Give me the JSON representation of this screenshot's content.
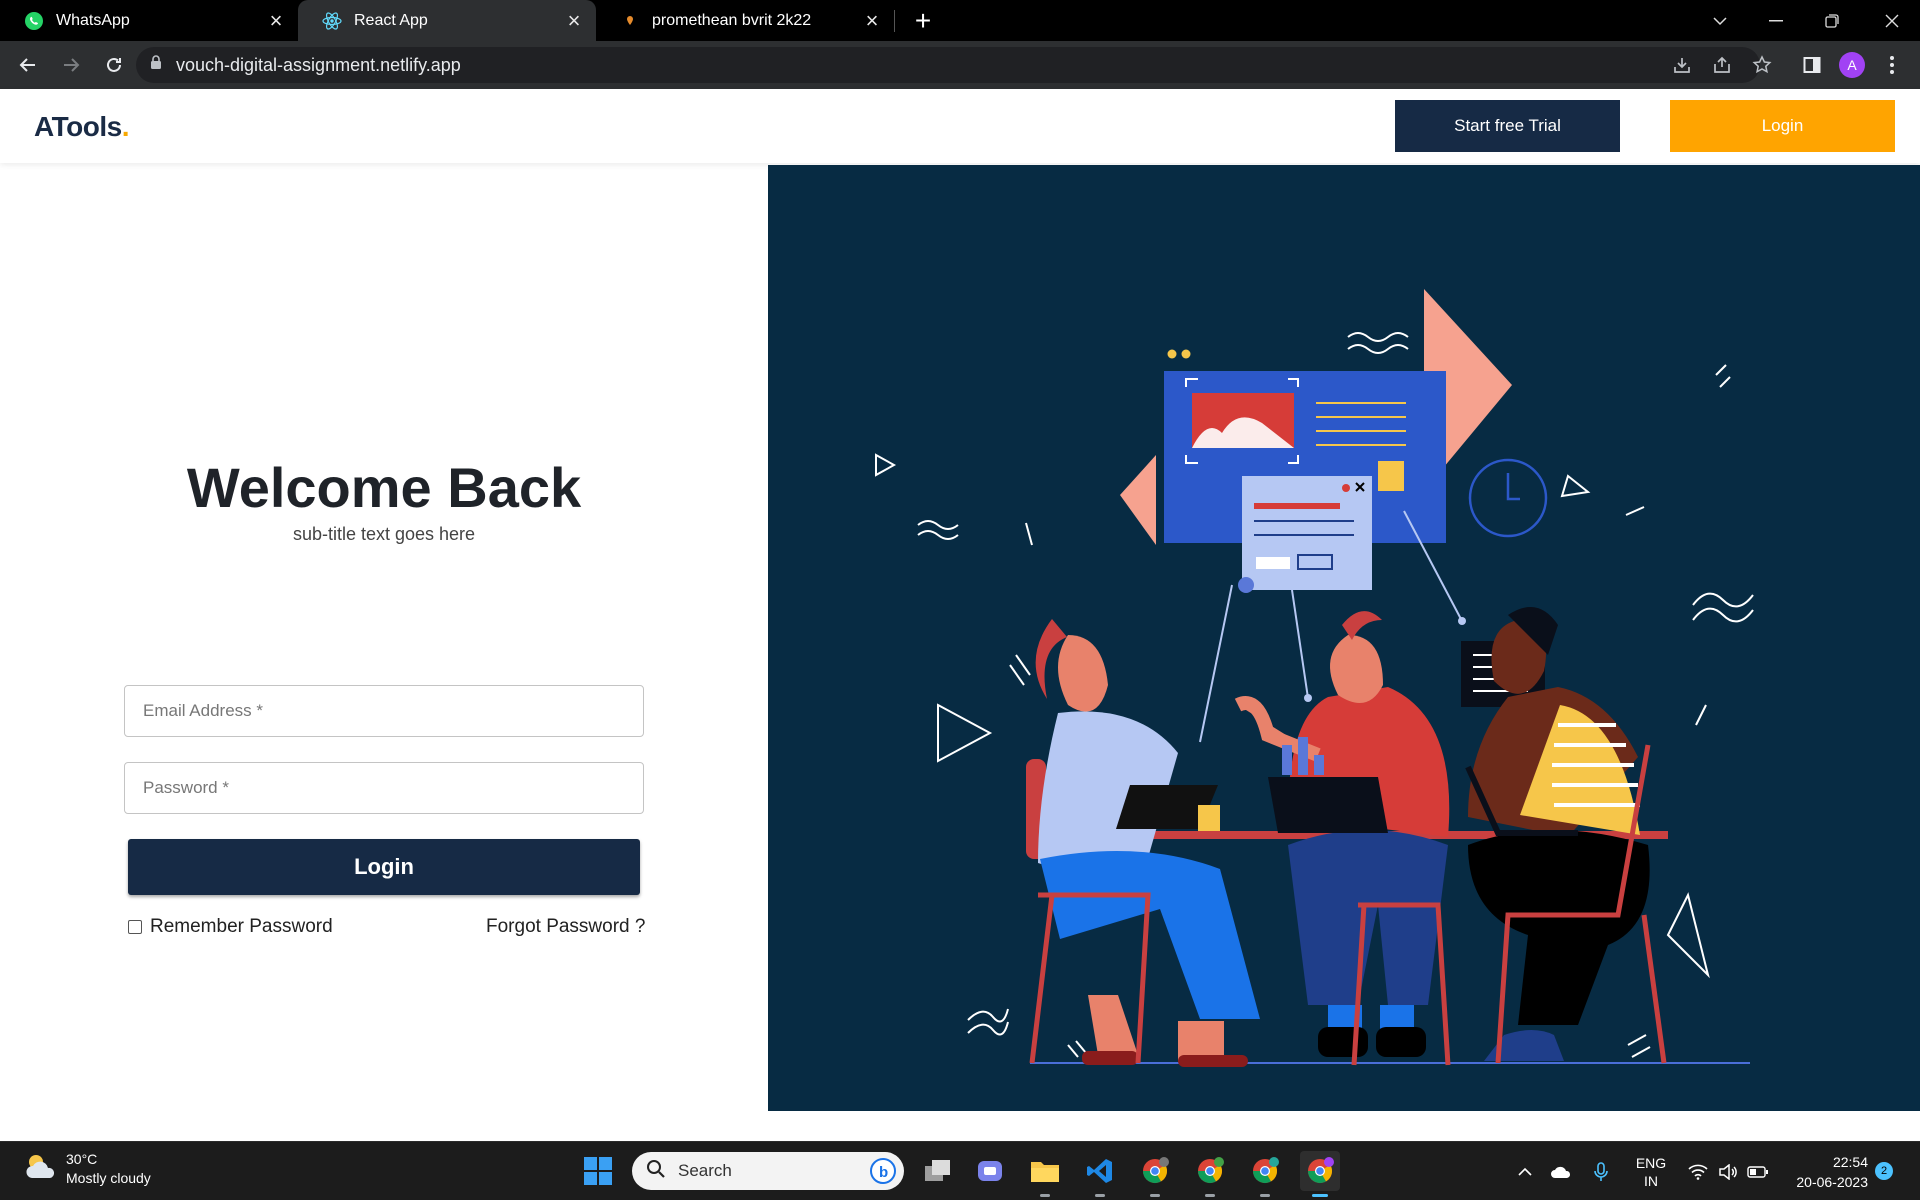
{
  "browser": {
    "tabs": [
      {
        "title": "WhatsApp",
        "icon": "whatsapp-icon",
        "active": false
      },
      {
        "title": "React App",
        "icon": "react-icon",
        "active": true
      },
      {
        "title": "promethean bvrit 2k22",
        "icon": "location-pin-icon",
        "active": false
      }
    ],
    "url": "vouch-digital-assignment.netlify.app",
    "profile_initial": "A"
  },
  "header": {
    "logo_text": "ATools",
    "logo_dot": ".",
    "trial_label": "Start free Trial",
    "login_label": "Login"
  },
  "form": {
    "title": "Welcome Back",
    "subtitle": "sub-title text goes here",
    "email_placeholder": "Email Address *",
    "password_placeholder": "Password *",
    "login_label": "Login",
    "remember_label": "Remember Password",
    "forgot_label": "Forgot Password ?"
  },
  "taskbar": {
    "temperature": "30°C",
    "weather": "Mostly cloudy",
    "search_placeholder": "Search",
    "lang_line1": "ENG",
    "lang_line2": "IN",
    "time": "22:54",
    "date": "20-06-2023",
    "notification_count": "2"
  },
  "colors": {
    "navy": "#162a45",
    "accent": "#ffa400",
    "hero_bg": "#072b43"
  }
}
